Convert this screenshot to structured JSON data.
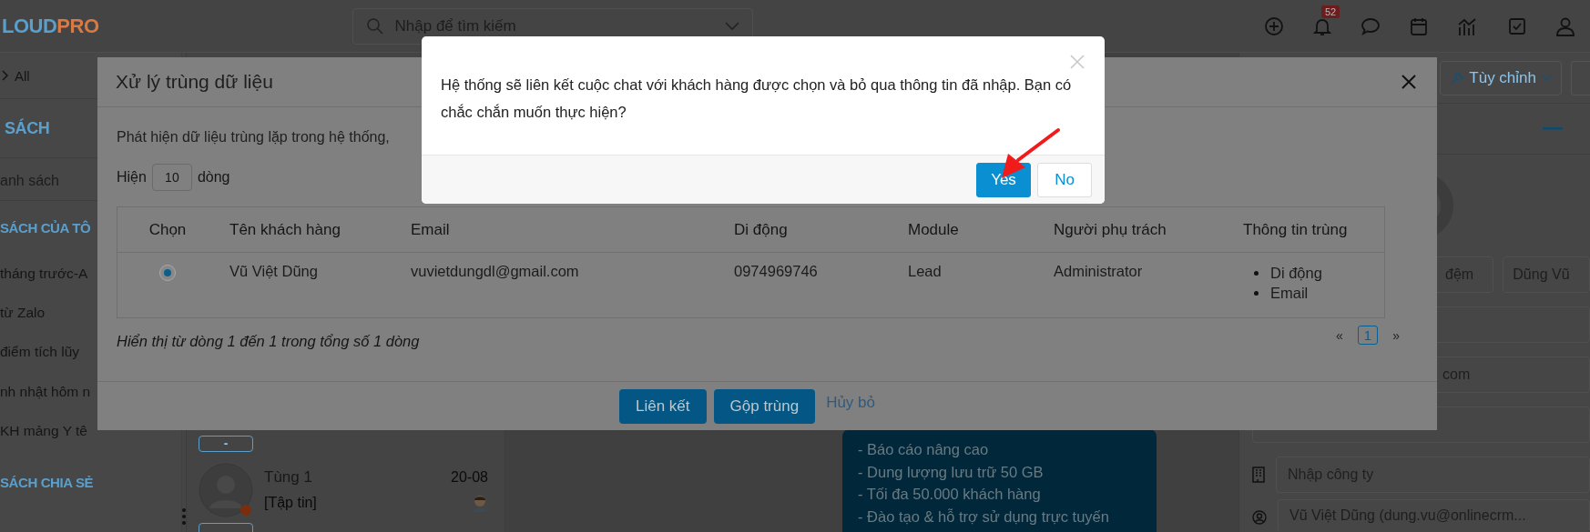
{
  "topbar": {
    "logo_first": "LOUD",
    "logo_second": "PRO",
    "search_placeholder": "Nhập để tìm kiếm",
    "notification_count": "52"
  },
  "sidebar": {
    "filter": "All",
    "heading": "SÁCH",
    "search_placeholder": "anh sách",
    "sections": [
      {
        "title": "SÁCH CỦA TÔ",
        "items": [
          "tháng trước-A",
          "từ Zalo",
          "điểm tích lũy",
          "nh nhật hôm n",
          "KH mảng Y tê"
        ]
      },
      {
        "title": "SÁCH CHIA SẺ"
      }
    ]
  },
  "chat_list": {
    "items": [
      {
        "tag": "-"
      },
      {
        "name": "Tùng 1",
        "date": "20-08",
        "preview": "[Tập tin]"
      }
    ]
  },
  "promo": {
    "lines": [
      "- Báo cáo nâng cao",
      "- Dung lượng lưu trữ 50 GB",
      "- Tối đa 50.000 khách hàng",
      "- Đào tạo & hỗ trợ sử dụng trực tuyến"
    ]
  },
  "contact_panel": {
    "customize_button": "Tùy chỉnh",
    "name_fields": [
      "đệm",
      "Dũng Vũ"
    ],
    "email_value": "com",
    "company_placeholder": "Nhập công ty",
    "owner_value": "Vũ Việt Dũng (dung.vu@onlinecrm..."
  },
  "modal": {
    "title": "Xử lý trùng dữ liệu",
    "description": "Phát hiện dữ liệu trùng lặp trong hệ thống,",
    "page_size_before": "Hiện",
    "page_size": "10",
    "page_size_after": "dòng",
    "table": {
      "columns": [
        "Chọn",
        "Tên khách hàng",
        "Email",
        "Di động",
        "Module",
        "Người phụ trách",
        "Thông tin trùng"
      ],
      "rows": [
        {
          "selected": true,
          "cells": [
            "",
            "Vũ Việt Dũng",
            "vuvietdungdl@gmail.com",
            "0974969746",
            "Lead",
            "Administrator"
          ],
          "duplicates": [
            "Di động",
            "Email"
          ]
        }
      ]
    },
    "summary": "Hiển thị từ dòng 1 đến 1 trong tổng số 1 dòng",
    "pagination": {
      "prev": "«",
      "pages": [
        {
          "label": "1",
          "selected": true
        }
      ],
      "next": "»"
    },
    "buttons": [
      {
        "label": "Liên kết",
        "kind": "primary"
      },
      {
        "label": "Gộp trùng",
        "kind": "primary"
      },
      {
        "label": "Hủy bỏ",
        "kind": "link"
      }
    ]
  },
  "confirm": {
    "message": "Hệ thống sẽ liên kết cuộc chat với khách hàng được chọn và bỏ qua thông tin đã nhập. Bạn có chắc chắn muốn thực hiện?",
    "buttons": [
      {
        "label": "Yes",
        "kind": "primary"
      },
      {
        "label": "No",
        "kind": "default"
      }
    ]
  }
}
